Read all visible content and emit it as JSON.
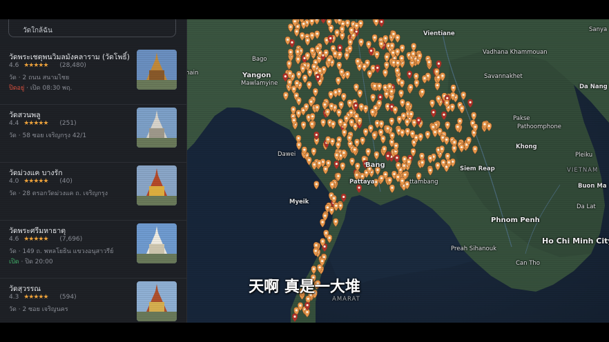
{
  "search": {
    "text": "วัดใกล้ฉัน"
  },
  "listings": [
    {
      "name": "วัดพระเชตุพนวิมลมังคลาราม (วัดโพธิ์)",
      "rating": "4.6",
      "stars": "★★★★★",
      "count": "(28,480)",
      "addr": "วัด · 2 ถนน สนามไชย",
      "status": "ปิดอยู่",
      "status_type": "closed",
      "hours": "· เปิด 08:30 พฤ."
    },
    {
      "name": "วัดสวนพลู",
      "rating": "4.4",
      "stars": "★★★★★",
      "count": "(251)",
      "addr": "วัด · 58 ซอย เจริญกรุง 42/1",
      "status": "",
      "status_type": "none",
      "hours": ""
    },
    {
      "name": "วัดม่วงแค บางรัก",
      "rating": "4.0",
      "stars": "★★★★★",
      "count": "(40)",
      "addr": "วัด · 28 ตรอกวัดม่วงแค ถ. เจริญกรุง",
      "status": "",
      "status_type": "none",
      "hours": ""
    },
    {
      "name": "วัดพระศรีมหาธาตุ",
      "rating": "4.6",
      "stars": "★★★★★",
      "count": "(7,696)",
      "addr": "วัด · 149 ถ. พหลโยธิน แขวงอนุสาวรีย์",
      "status": "เปิด",
      "status_type": "open",
      "hours": "· ปิด 20:00"
    },
    {
      "name": "วัดสุวรรณ",
      "rating": "4.3",
      "stars": "★★★★★",
      "count": "(594)",
      "addr": "วัด · 2 ซอย เจริญนคร",
      "status": "",
      "status_type": "none",
      "hours": ""
    }
  ],
  "places": {
    "vientiane": "Vientiane",
    "sanya": "Sanya",
    "bago": "Bago",
    "yangon": "Yangon",
    "mawlamyine": "Mawlamyine",
    "khammouan": "Vadhana Khammouan",
    "savannakhet": "Savannakhet",
    "danang": "Da Nang",
    "pakse": "Pakse",
    "pathoomphone": "Pathoomphone",
    "dawei": "Dawei",
    "khong": "Khong",
    "pleiku": "Pleiku",
    "siemreap": "Siem Reap",
    "vietnam": "VIETNAM",
    "buonma": "Buon Ma",
    "pattaya": "Pattaya",
    "bang": "Bang",
    "battambang": "ttambang",
    "dalat": "Da Lat",
    "myeik": "Myeik",
    "phnompenh": "Phnom Penh",
    "hochiminh": "Ho Chi Minh City",
    "sihanouk": "Preah Sihanouk",
    "cantho": "Can Tho",
    "nhai": "hain",
    "samarat": "AMARAT"
  },
  "subtitle": "天啊 真是一大堆"
}
